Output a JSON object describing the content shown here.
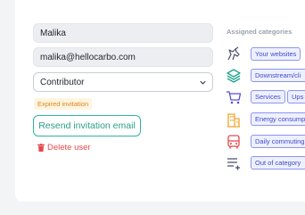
{
  "form": {
    "name_value": "Malika",
    "email_value": "malika@hellocarbo.com",
    "role_selected": "Contributor",
    "status_badge": "Expired invitation",
    "resend_label": "Resend invitation email",
    "delete_label": "Delete user"
  },
  "categories": {
    "title": "Assigned categories",
    "rows": [
      {
        "icon": "unicorn-icon",
        "chips": [
          "Your websites"
        ]
      },
      {
        "icon": "layers-icon",
        "chips": [
          "Downstream/cli"
        ]
      },
      {
        "icon": "shopping-cart-icon",
        "chips": [
          "Services",
          "Ups"
        ]
      },
      {
        "icon": "building-icon",
        "chips": [
          "Energy consump"
        ]
      },
      {
        "icon": "bus-icon",
        "chips": [
          "Daily commuting"
        ]
      },
      {
        "icon": "list-add-icon",
        "chips": [
          "Out of category"
        ]
      }
    ]
  },
  "colors": {
    "accent_teal": "#2fb59d",
    "danger": "#e5484d",
    "chip_blue": "#3f4bc8",
    "icon_teal": "#1fa38a",
    "icon_purple": "#5b4fcf",
    "icon_orange": "#f0a52a",
    "icon_red": "#e5484d",
    "icon_navy": "#4a4f6a"
  }
}
